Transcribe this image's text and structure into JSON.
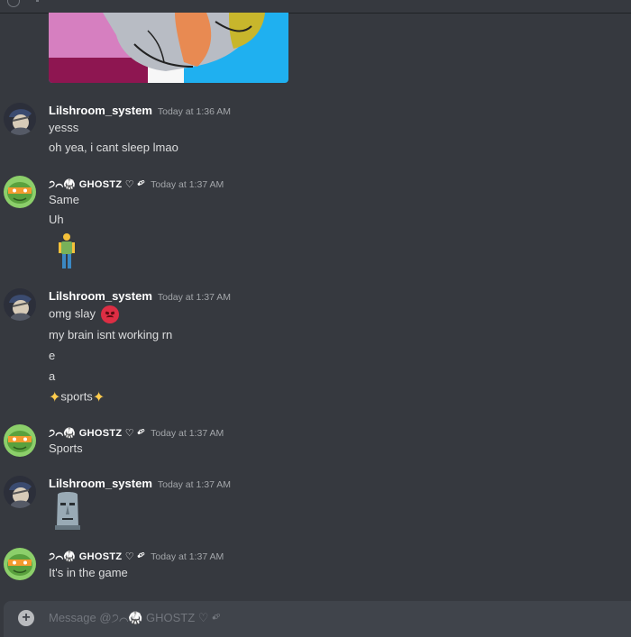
{
  "composer": {
    "placeholder": "Message @੭⌒🥋 GHOSTZ ♡ •ͦ°"
  },
  "messages": [
    {
      "username": "Lilshroom_system",
      "timestamp": "Today at 1:36 AM",
      "lines": [
        "yesss",
        "oh yea, i cant sleep lmao"
      ]
    },
    {
      "username": "੭⌒🥋 GHOSTZ ♡ •ͦ°",
      "timestamp": "Today at 1:37 AM",
      "lines": [
        "Same",
        "Uh"
      ],
      "emoji": "person-standing"
    },
    {
      "username": "Lilshroom_system",
      "timestamp": "Today at 1:37 AM",
      "lines": [
        "omg slay",
        "my brain isnt working rn",
        "e",
        "a",
        "sports"
      ],
      "emojis": [
        "angry-face",
        "sparkles"
      ]
    },
    {
      "username": "੭⌒🥋 GHOSTZ ♡ •ͦ°",
      "timestamp": "Today at 1:37 AM",
      "lines": [
        "Sports"
      ]
    },
    {
      "username": "Lilshroom_system",
      "timestamp": "Today at 1:37 AM",
      "emoji": "moai"
    },
    {
      "username": "੭⌒🥋 GHOSTZ ♡ •ͦ°",
      "timestamp": "Today at 1:37 AM",
      "lines": [
        "It's in the game"
      ]
    }
  ],
  "colors": {
    "background": "#36393f",
    "composer": "#40444b",
    "username": "#ffffff",
    "timestamp": "#a3a6aa",
    "text": "#dcddde"
  }
}
